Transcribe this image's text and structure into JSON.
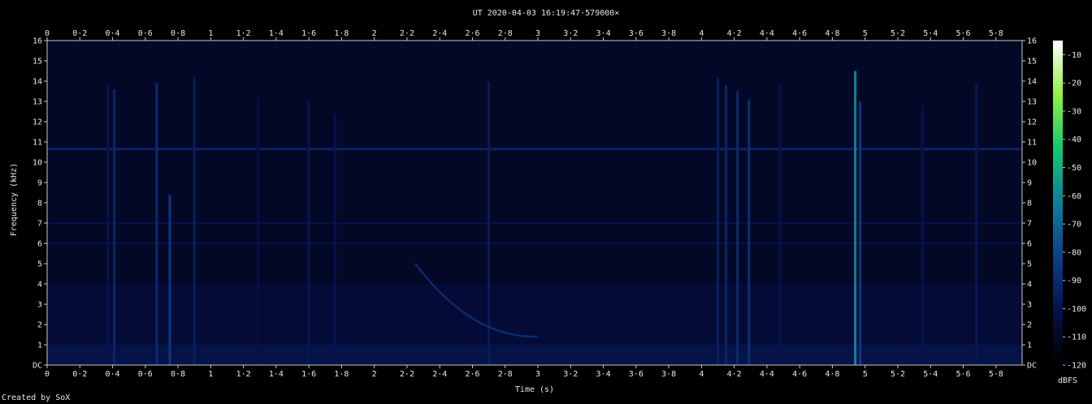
{
  "chart_data": {
    "type": "heatmap",
    "title": "UT 2020-04-03 16:19:47·579000×",
    "xlabel": "Time (s)",
    "ylabel": "Frequency (kHz)",
    "xlim": [
      0,
      5.96
    ],
    "ylim": [
      0,
      16
    ],
    "x_ticks": [
      "0",
      "0·2",
      "0·4",
      "0·6",
      "0·8",
      "1",
      "1·2",
      "1·4",
      "1·6",
      "1·8",
      "2",
      "2·2",
      "2·4",
      "2·6",
      "2·8",
      "3",
      "3·2",
      "3·4",
      "3·6",
      "3·8",
      "4",
      "4·2",
      "4·4",
      "4·6",
      "4·8",
      "5",
      "5·2",
      "5·4",
      "5·6",
      "5·8"
    ],
    "x_tick_values": [
      0,
      0.2,
      0.4,
      0.6,
      0.8,
      1,
      1.2,
      1.4,
      1.6,
      1.8,
      2,
      2.2,
      2.4,
      2.6,
      2.8,
      3,
      3.2,
      3.4,
      3.6,
      3.8,
      4,
      4.2,
      4.4,
      4.6,
      4.8,
      5,
      5.2,
      5.4,
      5.6,
      5.8
    ],
    "y_ticks": [
      "DC",
      "1",
      "2",
      "3",
      "4",
      "5",
      "6",
      "7",
      "8",
      "9",
      "10",
      "11",
      "12",
      "13",
      "14",
      "15",
      "16"
    ],
    "y_tick_values": [
      0,
      1,
      2,
      3,
      4,
      5,
      6,
      7,
      8,
      9,
      10,
      11,
      12,
      13,
      14,
      15,
      16
    ],
    "colorbar": {
      "label": "dBFS",
      "ticks": [
        "-10",
        "-20",
        "-30",
        "-40",
        "-50",
        "-60",
        "-70",
        "-80",
        "-90",
        "-100",
        "-110",
        "-120"
      ],
      "tick_values": [
        -10,
        -20,
        -30,
        -40,
        -50,
        -60,
        -70,
        -80,
        -90,
        -100,
        -110,
        -120
      ],
      "range": [
        -120,
        -5
      ],
      "colors": [
        "#000000",
        "#06104a",
        "#0e3e8a",
        "#0f7f9a",
        "#10c870",
        "#90f040",
        "#ffffff"
      ]
    },
    "features": {
      "background_level_dBFS": -110,
      "horizontal_tone_kHz": 10.65,
      "horizontal_bands_kHz": [
        6,
        7
      ],
      "vertical_impulses": [
        {
          "t": 0.37,
          "f_top": 13.8,
          "level": -100
        },
        {
          "t": 0.41,
          "f_top": 13.6,
          "level": -92
        },
        {
          "t": 0.67,
          "f_top": 13.9,
          "level": -90
        },
        {
          "t": 0.75,
          "f_top": 8.4,
          "level": -85
        },
        {
          "t": 0.9,
          "f_top": 14.2,
          "level": -95
        },
        {
          "t": 1.29,
          "f_top": 13.2,
          "level": -102
        },
        {
          "t": 1.6,
          "f_top": 13.0,
          "level": -98
        },
        {
          "t": 1.76,
          "f_top": 12.4,
          "level": -100
        },
        {
          "t": 2.7,
          "f_top": 14.0,
          "level": -96
        },
        {
          "t": 4.1,
          "f_top": 14.2,
          "level": -95
        },
        {
          "t": 4.15,
          "f_top": 13.8,
          "level": -92
        },
        {
          "t": 4.22,
          "f_top": 13.5,
          "level": -90
        },
        {
          "t": 4.29,
          "f_top": 13.1,
          "level": -88
        },
        {
          "t": 4.48,
          "f_top": 13.9,
          "level": -100
        },
        {
          "t": 4.94,
          "f_top": 14.5,
          "level": -62
        },
        {
          "t": 4.97,
          "f_top": 13.0,
          "level": -85
        },
        {
          "t": 5.35,
          "f_top": 12.8,
          "level": -100
        },
        {
          "t": 5.68,
          "f_top": 13.9,
          "level": -98
        }
      ],
      "whistler": {
        "t_start": 2.25,
        "t_end": 3.0,
        "f_start_kHz": 5.0,
        "f_end_kHz": 1.4,
        "level": -88
      }
    }
  },
  "footer": {
    "credit": "Created by SoX"
  }
}
